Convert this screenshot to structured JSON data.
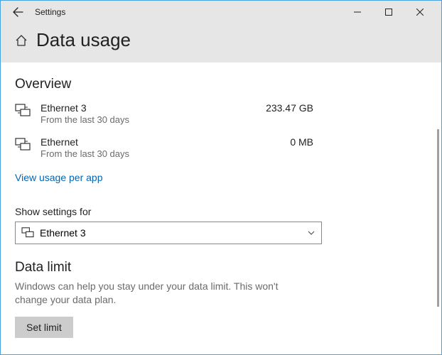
{
  "window": {
    "title": "Settings"
  },
  "header": {
    "title": "Data usage"
  },
  "overview": {
    "heading": "Overview",
    "networks": [
      {
        "name": "Ethernet 3",
        "period": "From the last 30 days",
        "usage": "233.47 GB"
      },
      {
        "name": "Ethernet",
        "period": "From the last 30 days",
        "usage": "0 MB"
      }
    ],
    "view_per_app_link": "View usage per app"
  },
  "settings_for": {
    "label": "Show settings for",
    "selected": "Ethernet 3"
  },
  "data_limit": {
    "heading": "Data limit",
    "description": "Windows can help you stay under your data limit. This won't change your data plan.",
    "button": "Set limit"
  }
}
